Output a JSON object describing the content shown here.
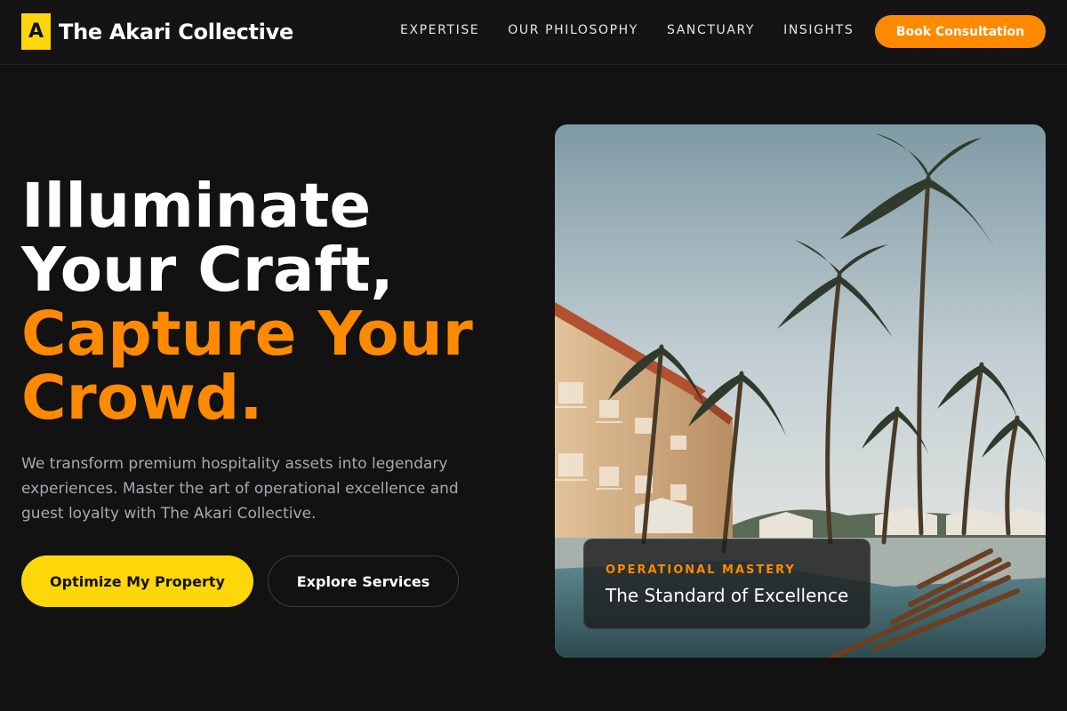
{
  "header": {
    "brand_mark": "A",
    "brand_name": "The Akari Collective",
    "nav": [
      "EXPERTISE",
      "OUR PHILOSOPHY",
      "SANCTUARY",
      "INSIGHTS"
    ],
    "cta_label": "Book Consultation"
  },
  "hero": {
    "headline_lines": [
      "Illuminate",
      "Your Craft,"
    ],
    "headline_accent_lines": [
      "Capture Your",
      "Crowd."
    ],
    "description": "We transform premium hospitality assets into legendary experiences. Master the art of operational excellence and guest loyalty with The Akari Collective.",
    "primary_button": "Optimize My Property",
    "secondary_button": "Explore Services"
  },
  "card": {
    "kicker": "OPERATIONAL MASTERY",
    "title": "The Standard of Excellence"
  },
  "colors": {
    "accent_orange": "#FF8A00",
    "accent_yellow": "#FFD60A",
    "background": "#121212"
  }
}
